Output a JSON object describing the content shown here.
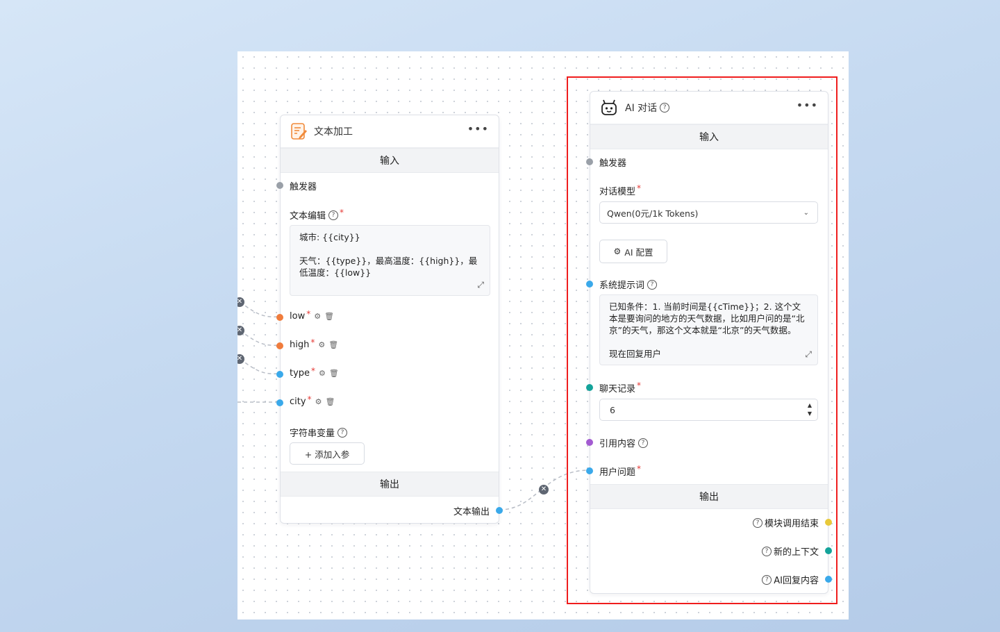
{
  "text_node": {
    "title": "文本加工",
    "more": "•••",
    "input_section": "输入",
    "trigger_label": "触发器",
    "text_edit_label": "文本编辑",
    "text_line1": "城市: {{city}}",
    "text_line2": "天气：{{type}}，最高温度：{{high}}，最低温度：{{low}}",
    "params": [
      {
        "name": "low"
      },
      {
        "name": "high"
      },
      {
        "name": "type"
      },
      {
        "name": "city"
      }
    ],
    "string_var_label": "字符串变量",
    "add_param_button": "+ 添加入参",
    "output_section": "输出",
    "text_output_label": "文本输出"
  },
  "ai_node": {
    "title": "AI 对话",
    "more": "•••",
    "input_section": "输入",
    "trigger_label": "触发器",
    "model_label": "对话模型",
    "model_value": "Qwen(0元/1k Tokens)",
    "ai_config_button": "AI 配置",
    "system_prompt_label": "系统提示词",
    "system_prompt_text": "已知条件：1. 当前时间是{{cTime}}；2. 这个文本是要询问的地方的天气数据，比如用户问的是“北京”的天气，那这个文本就是“北京”的天气数据。",
    "system_prompt_text2": "现在回复用户",
    "history_label": "聊天记录",
    "history_value": "6",
    "quote_label": "引用内容",
    "user_question_label": "用户问题",
    "output_section": "输出",
    "outputs": [
      {
        "label": "模块调用结束"
      },
      {
        "label": "新的上下文"
      },
      {
        "label": "AI回复内容"
      }
    ]
  },
  "colors": {
    "gray_dot": "#9aa0a8",
    "orange_dot": "#f07c3c",
    "blue_dot": "#3aa9ea",
    "teal_dot": "#14a39a",
    "purple_dot": "#a35bd1",
    "yellow_dot": "#e8c93a",
    "highlight_border": "#ef1d1d"
  },
  "icons": {
    "text_node": "edit-document-icon",
    "ai_node": "robot-icon",
    "ai_config": "gear-icon",
    "delete": "trash-icon",
    "expand": "expand-icon",
    "dropdown": "chevron-down-icon",
    "help": "question-circle-icon",
    "disconnect": "close-circle-icon"
  }
}
